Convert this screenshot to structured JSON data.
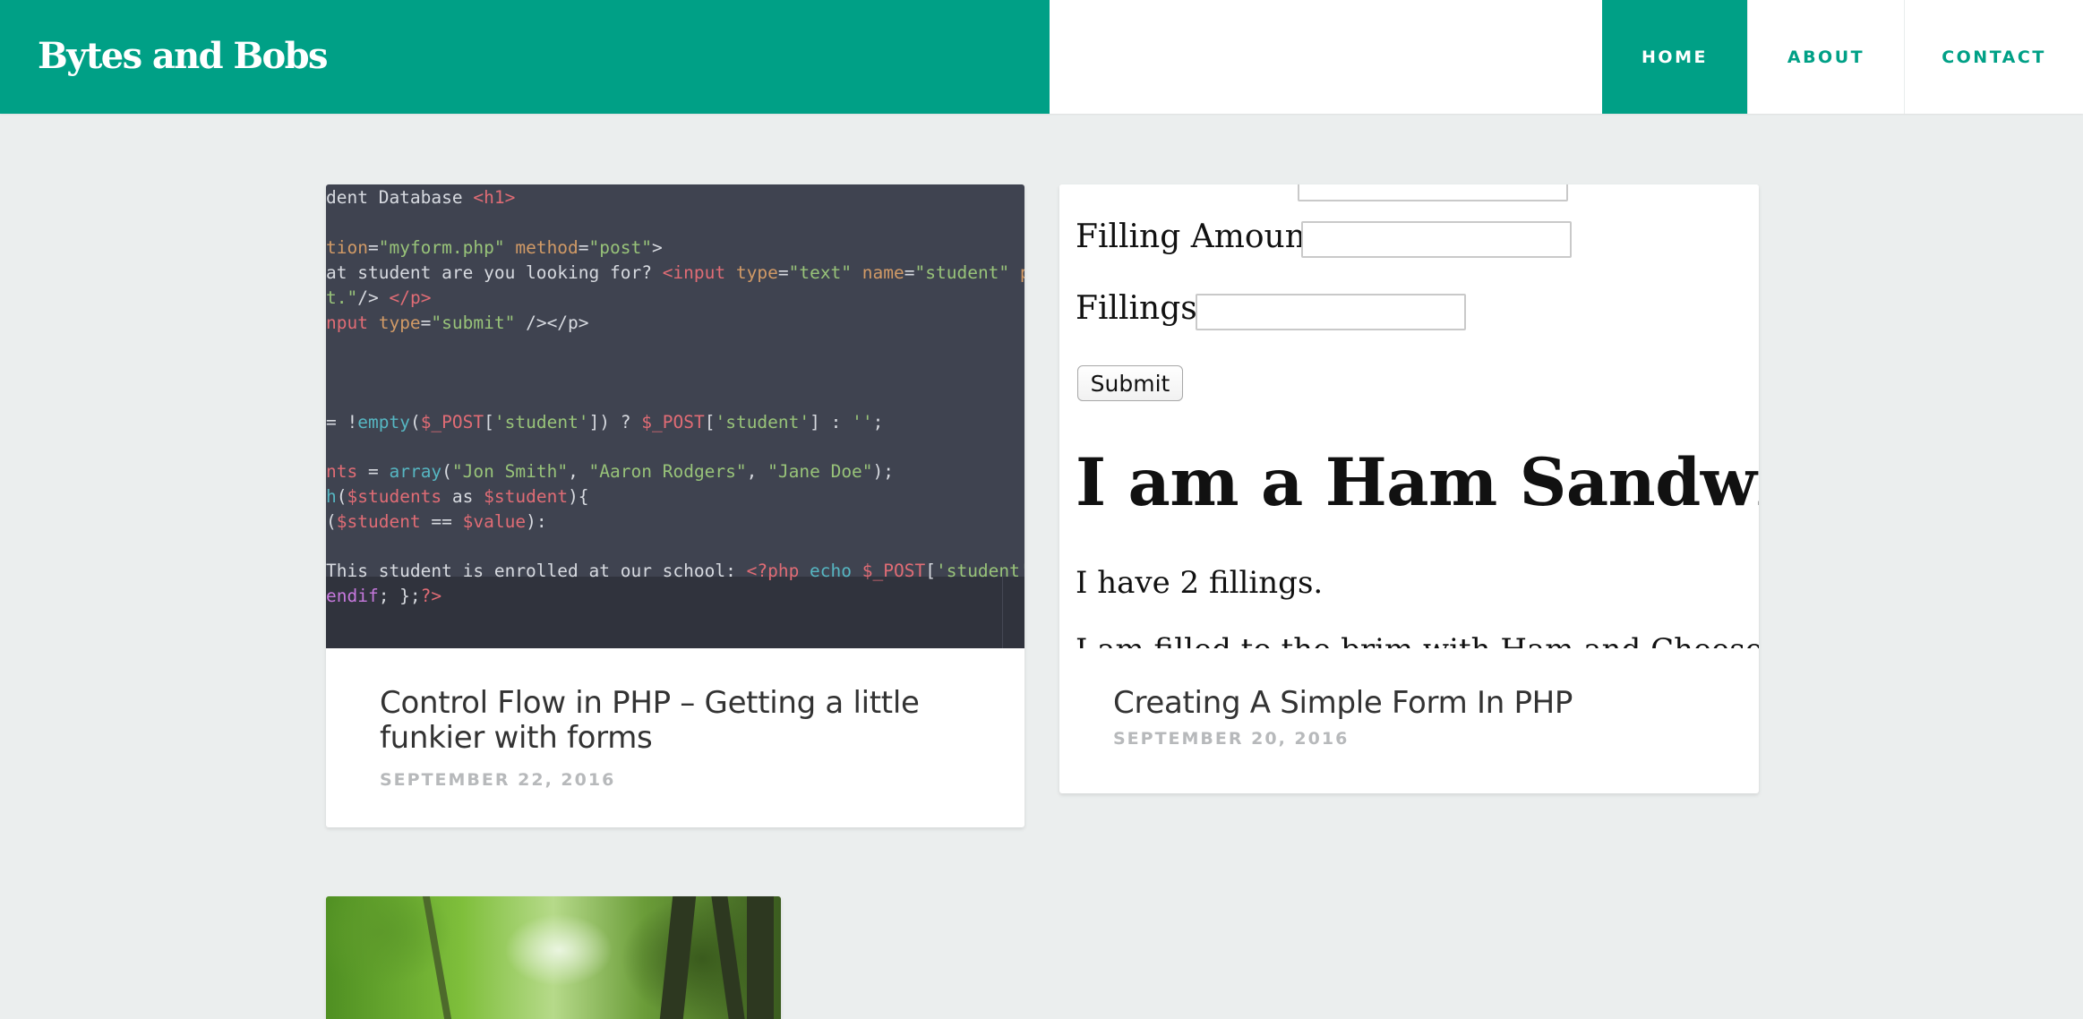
{
  "site": {
    "title": "Bytes and Bobs"
  },
  "nav": {
    "home": "HOME",
    "about": "ABOUT",
    "contact": "CONTACT"
  },
  "colors": {
    "brand": "#00a086",
    "background": "#ebeeee",
    "date": "#b7b9bb"
  },
  "posts": [
    {
      "title": "Control Flow in PHP – Getting a little funkier with forms",
      "date": "SEPTEMBER 22, 2016",
      "thumbnail": "code-editor-screenshot",
      "code": {
        "l1a": "dent Database ",
        "l1b": "<h1>",
        "l2a": "tion",
        "l2b": "=",
        "l2c": "\"myform.php\"",
        "l2d": " method",
        "l2e": "=",
        "l2f": "\"post\"",
        "l2g": ">",
        "l3a": "at student are you looking for? ",
        "l3b": "<input",
        "l3c": " type",
        "l3d": "=",
        "l3e": "\"text\"",
        "l3f": " name",
        "l3g": "=",
        "l3h": "\"student\"",
        "l3i": " place",
        "l4a": "t.\"",
        "l4b": "/> ",
        "l4c": "</p>",
        "l5a": "nput",
        "l5b": " type",
        "l5c": "=",
        "l5d": "\"submit\"",
        "l5e": " /></p>",
        "l6a": " = !",
        "l6b": "empty",
        "l6c": "(",
        "l6d": "$_POST",
        "l6e": "[",
        "l6f": "'student'",
        "l6g": "]) ? ",
        "l6h": "$_POST",
        "l6i": "[",
        "l6j": "'student'",
        "l6k": "] : ",
        "l6l": "''",
        "l6m": ";",
        "l7a": "nts",
        "l7b": " = ",
        "l7c": "array",
        "l7d": "(",
        "l7e": "\"Jon Smith\"",
        "l7f": ", ",
        "l7g": "\"Aaron Rodgers\"",
        "l7h": ", ",
        "l7i": "\"Jane Doe\"",
        "l7j": ");",
        "l8a": "h",
        "l8b": "(",
        "l8c": "$students",
        "l8d": " as ",
        "l8e": "$student",
        "l8f": "){",
        "l9a": "(",
        "l9b": "$student",
        "l9c": " == ",
        "l9d": "$value",
        "l9e": "):",
        "l10a": "This student is enrolled at our school:  ",
        "l10b": "<?php",
        "l10c": " echo ",
        "l10d": "$_POST",
        "l10e": "[",
        "l10f": "'student'",
        "l10g": "];",
        "l11a": "endif",
        "l11b": "; };",
        "l11c": "?>"
      }
    },
    {
      "title": "Creating A Simple Form In PHP",
      "date": "SEPTEMBER 20, 2016",
      "thumbnail": "html-form-screenshot",
      "form": {
        "filling_amount_label": "Filling Amount:",
        "fillings_label": "Fillings:",
        "submit_label": "Submit",
        "heading": "I am a Ham Sandwich!",
        "para1": "I have 2 fillings.",
        "para2": "I am filled to the brim with Ham and Cheese"
      }
    },
    {
      "thumbnail": "forest-photo"
    }
  ]
}
